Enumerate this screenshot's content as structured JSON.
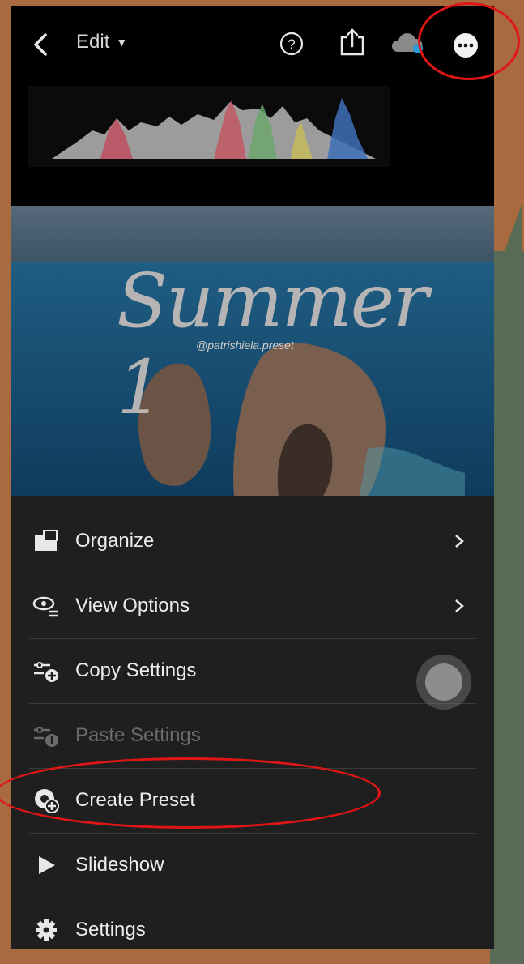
{
  "topbar": {
    "edit_label": "Edit",
    "icons": [
      "back-icon",
      "help-icon",
      "share-icon",
      "cloud-sync-icon",
      "more-options-icon"
    ]
  },
  "photo": {
    "title_text": "Summer 1",
    "handle_text": "@patrishiela.preset"
  },
  "menu": {
    "items": [
      {
        "label": "Organize",
        "icon": "organize-icon",
        "has_chevron": true,
        "enabled": true
      },
      {
        "label": "View Options",
        "icon": "view-options-icon",
        "has_chevron": true,
        "enabled": true
      },
      {
        "label": "Copy Settings",
        "icon": "copy-settings-icon",
        "has_chevron": false,
        "enabled": true
      },
      {
        "label": "Paste Settings",
        "icon": "paste-settings-icon",
        "has_chevron": false,
        "enabled": false
      },
      {
        "label": "Create Preset",
        "icon": "create-preset-icon",
        "has_chevron": false,
        "enabled": true
      },
      {
        "label": "Slideshow",
        "icon": "play-icon",
        "has_chevron": false,
        "enabled": true
      },
      {
        "label": "Settings",
        "icon": "gear-icon",
        "has_chevron": false,
        "enabled": true
      }
    ]
  },
  "colors": {
    "annotation": "#e01616",
    "menu_bg": "#1f1f1f",
    "text": "#ececec",
    "disabled_text": "#6b6b6b"
  }
}
